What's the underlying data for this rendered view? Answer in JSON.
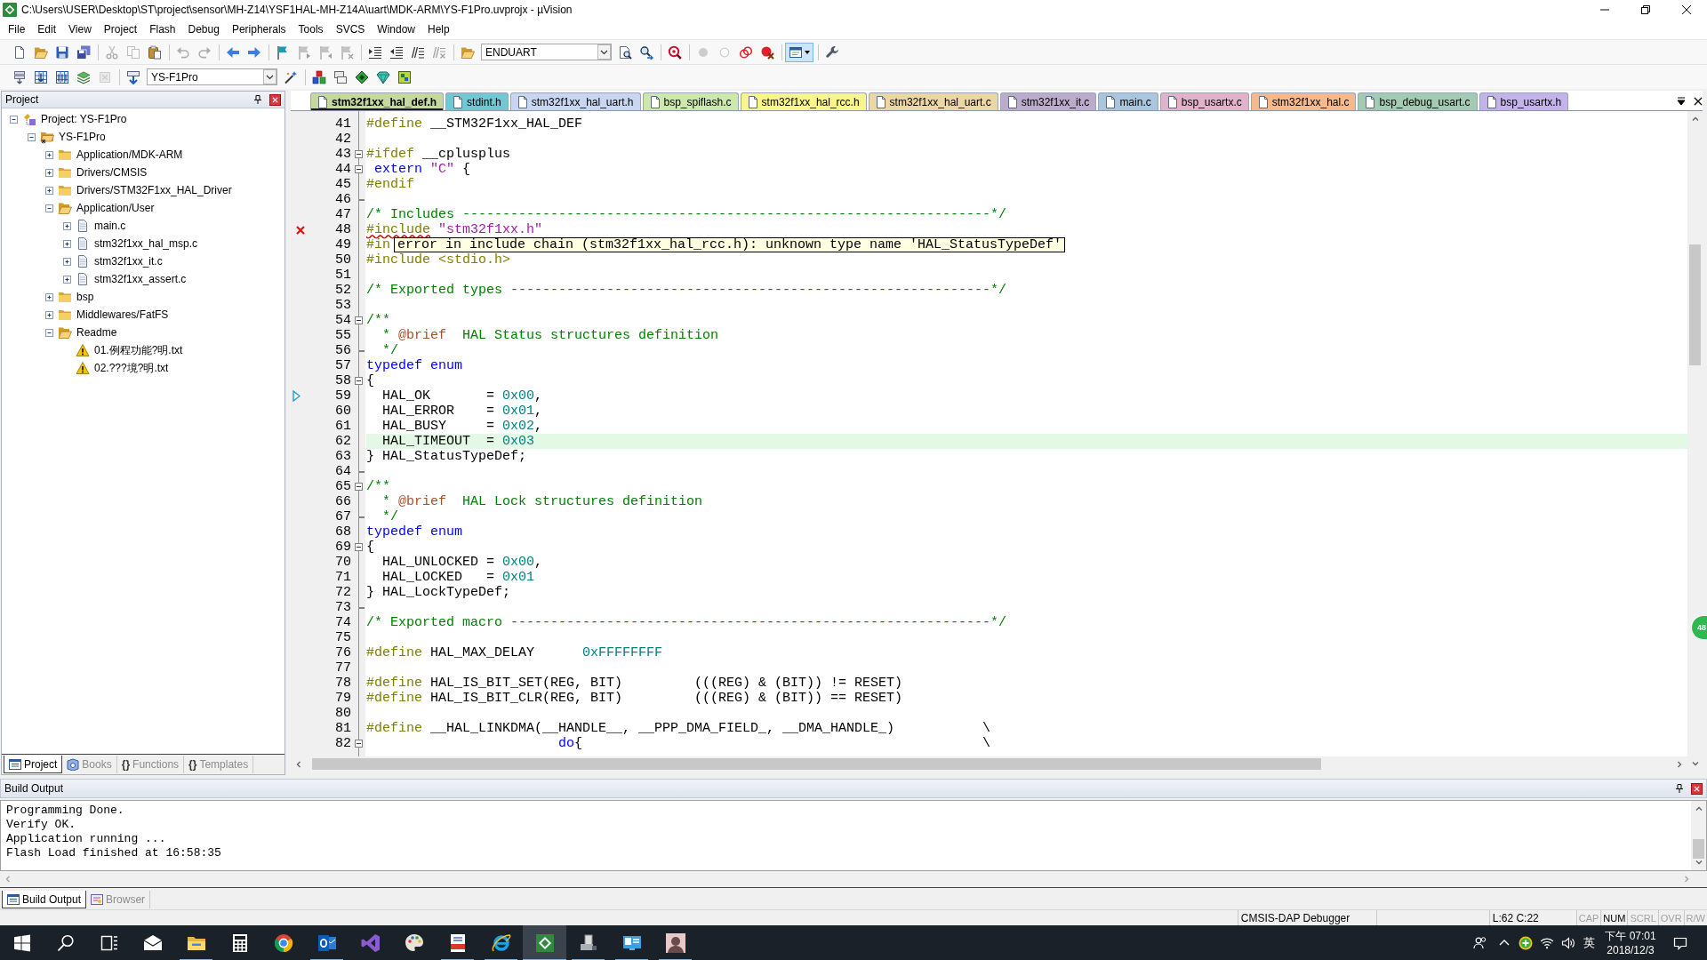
{
  "window": {
    "title": "C:\\Users\\USER\\Desktop\\ST\\project\\sensor\\MH-Z14\\YSF1HAL-MH-Z14A\\uart\\MDK-ARM\\YS-F1Pro.uvprojx - µVision"
  },
  "menu": [
    "File",
    "Edit",
    "View",
    "Project",
    "Flash",
    "Debug",
    "Peripherals",
    "Tools",
    "SVCS",
    "Window",
    "Help"
  ],
  "toolbars": [
    [
      [
        {
          "kind": "new",
          "disabled": false
        },
        {
          "kind": "open",
          "disabled": false
        },
        {
          "kind": "save",
          "disabled": false
        },
        {
          "kind": "save-all",
          "disabled": false
        }
      ],
      [
        {
          "kind": "cut",
          "disabled": true
        },
        {
          "kind": "copy",
          "disabled": true
        },
        {
          "kind": "paste",
          "disabled": false
        }
      ],
      [
        {
          "kind": "undo",
          "disabled": true
        },
        {
          "kind": "redo",
          "disabled": true
        }
      ],
      [
        {
          "kind": "back",
          "disabled": false
        },
        {
          "kind": "forward",
          "disabled": false
        }
      ],
      [
        {
          "kind": "bookmark",
          "disabled": false
        },
        {
          "kind": "prev-bookmark",
          "disabled": true
        },
        {
          "kind": "next-bookmark",
          "disabled": true
        },
        {
          "kind": "clear-bookmarks",
          "disabled": true
        }
      ],
      [
        {
          "kind": "indent",
          "disabled": false
        },
        {
          "kind": "unindent",
          "disabled": false
        },
        {
          "kind": "comment",
          "disabled": false
        },
        {
          "kind": "uncomment",
          "disabled": true
        }
      ],
      [
        {
          "kind": "find-files",
          "disabled": false
        },
        {
          "kind": "combo",
          "value": "ENDUART",
          "disabled": false
        },
        {
          "kind": "find",
          "disabled": false
        },
        {
          "kind": "find-next",
          "disabled": false
        }
      ],
      [
        {
          "kind": "debug",
          "disabled": false
        }
      ],
      [
        {
          "kind": "breakpoint",
          "disabled": true
        },
        {
          "kind": "enable-breakpoint",
          "disabled": true
        },
        {
          "kind": "disable-breakpoints",
          "disabled": false
        },
        {
          "kind": "kill-breakpoints",
          "disabled": false
        }
      ],
      [
        {
          "kind": "window",
          "pressed": true
        }
      ],
      [
        {
          "kind": "configure",
          "disabled": false
        }
      ]
    ],
    [
      [
        {
          "kind": "translate",
          "disabled": false
        },
        {
          "kind": "build",
          "disabled": false
        },
        {
          "kind": "rebuild",
          "disabled": false
        },
        {
          "kind": "batch-build",
          "disabled": false
        },
        {
          "kind": "stop-build",
          "disabled": true
        }
      ],
      [
        {
          "kind": "download",
          "disabled": false
        },
        {
          "kind": "combo",
          "value": "YS-F1Pro",
          "disabled": false
        },
        {
          "kind": "options",
          "disabled": false
        }
      ],
      [
        {
          "kind": "manage",
          "disabled": false
        },
        {
          "kind": "environment",
          "disabled": false
        },
        {
          "kind": "diamond",
          "disabled": false
        },
        {
          "kind": "gem",
          "disabled": false
        },
        {
          "kind": "pack",
          "disabled": false
        }
      ]
    ]
  ],
  "project_panel": {
    "title": "Project",
    "tree": [
      {
        "label": "Project: YS-F1Pro",
        "kind": "project",
        "expanded": true,
        "children": [
          {
            "label": "YS-F1Pro",
            "kind": "target",
            "expanded": true,
            "children": [
              {
                "label": "Application/MDK-ARM",
                "kind": "folder",
                "expanded": false
              },
              {
                "label": "Drivers/CMSIS",
                "kind": "folder",
                "expanded": false
              },
              {
                "label": "Drivers/STM32F1xx_HAL_Driver",
                "kind": "folder",
                "expanded": false
              },
              {
                "label": "Application/User",
                "kind": "folder",
                "expanded": true,
                "children": [
                  {
                    "label": "main.c",
                    "kind": "file",
                    "expanded": false
                  },
                  {
                    "label": "stm32f1xx_hal_msp.c",
                    "kind": "file",
                    "expanded": false
                  },
                  {
                    "label": "stm32f1xx_it.c",
                    "kind": "file",
                    "expanded": false
                  },
                  {
                    "label": "stm32f1xx_assert.c",
                    "kind": "file",
                    "expanded": false
                  }
                ]
              },
              {
                "label": "bsp",
                "kind": "folder",
                "expanded": false
              },
              {
                "label": "Middlewares/FatFS",
                "kind": "folder",
                "expanded": false
              },
              {
                "label": "Readme",
                "kind": "folder",
                "expanded": true,
                "children": [
                  {
                    "label": "01.例程功能?明.txt",
                    "kind": "warning-file"
                  },
                  {
                    "label": "02.???境?明.txt",
                    "kind": "warning-file"
                  }
                ]
              }
            ]
          }
        ]
      }
    ],
    "tabs": [
      {
        "kind": "project",
        "label": "Project",
        "selected": true
      },
      {
        "kind": "books",
        "label": "Books",
        "selected": false
      },
      {
        "kind": "functions",
        "glyph": "{}",
        "label": "Functions",
        "selected": false
      },
      {
        "kind": "templates",
        "glyph": "{}",
        "label": "Templates",
        "selected": false
      }
    ]
  },
  "editor": {
    "tabs": [
      {
        "label": "stm32f1xx_hal_def.h",
        "color": "#c5d99e",
        "selected": true
      },
      {
        "label": "stdint.h",
        "color": "#72c8d2",
        "selected": false
      },
      {
        "label": "stm32f1xx_hal_uart.h",
        "color": "#c9d6f2",
        "selected": false
      },
      {
        "label": "bsp_spiflash.c",
        "color": "#cde8ac",
        "selected": false
      },
      {
        "label": "stm32f1xx_hal_rcc.h",
        "color": "#f8f58c",
        "selected": false
      },
      {
        "label": "stm32f1xx_hal_uart.c",
        "color": "#ebd7a6",
        "selected": false
      },
      {
        "label": "stm32f1xx_it.c",
        "color": "#bcaccc",
        "selected": false
      },
      {
        "label": "main.c",
        "color": "#a9c6de",
        "selected": false
      },
      {
        "label": "bsp_usartx.c",
        "color": "#e2b2ca",
        "selected": false
      },
      {
        "label": "stm32f1xx_hal.c",
        "color": "#f6b98c",
        "selected": false
      },
      {
        "label": "bsp_debug_usart.c",
        "color": "#a3cbb3",
        "selected": false
      },
      {
        "label": "bsp_usartx.h",
        "color": "#c3b3ea",
        "selected": false
      }
    ],
    "lines": [
      {
        "number": "41",
        "kind": "text",
        "highlighted": false,
        "tokens": [
          {
            "kind": "preproc",
            "text": "#define"
          },
          {
            "kind": "plain",
            "text": " __STM32F1xx_HAL_DEF"
          }
        ]
      },
      {
        "number": "42",
        "kind": "text",
        "highlighted": false
      },
      {
        "number": "43",
        "kind": "fold-start",
        "highlighted": false,
        "tokens": [
          {
            "kind": "preproc",
            "text": "#ifdef"
          },
          {
            "kind": "plain",
            "text": " __cplusplus"
          }
        ]
      },
      {
        "number": "44",
        "kind": "fold-start",
        "highlighted": false,
        "tokens": [
          {
            "kind": "keyword",
            "text": " extern"
          },
          {
            "kind": "string",
            "text": " \"C\""
          },
          {
            "kind": "plain",
            "text": " {"
          }
        ]
      },
      {
        "number": "45",
        "kind": "text",
        "highlighted": false,
        "tokens": [
          {
            "kind": "preproc",
            "text": "#endif"
          }
        ]
      },
      {
        "number": "46",
        "kind": "fold-end",
        "highlighted": false
      },
      {
        "number": "47",
        "kind": "text",
        "highlighted": false,
        "tokens": [
          {
            "kind": "comment",
            "text": "/* Includes ------------------------------------------------------------------*/"
          }
        ]
      },
      {
        "number": "48",
        "kind": "error",
        "highlighted": false,
        "tokens": [
          {
            "kind": "error",
            "text": "#include"
          },
          {
            "kind": "string",
            "text": " \"stm32f1xx.h\""
          }
        ]
      },
      {
        "number": "49",
        "kind": "text",
        "highlighted": false,
        "tokens": [
          {
            "kind": "preproc",
            "text": "#in"
          }
        ],
        "tooltip": "error in include chain (stm32f1xx_hal_rcc.h): unknown type name 'HAL_StatusTypeDef'"
      },
      {
        "number": "50",
        "kind": "text",
        "highlighted": false,
        "tokens": [
          {
            "kind": "preproc",
            "text": "#include <stdio.h>"
          }
        ]
      },
      {
        "number": "51",
        "kind": "text",
        "highlighted": false
      },
      {
        "number": "52",
        "kind": "text",
        "highlighted": false,
        "tokens": [
          {
            "kind": "comment",
            "text": "/* Exported types ------------------------------------------------------------*/"
          }
        ]
      },
      {
        "number": "53",
        "kind": "text",
        "highlighted": false
      },
      {
        "number": "54",
        "kind": "fold-start",
        "highlighted": false,
        "tokens": [
          {
            "kind": "comment",
            "text": "/**"
          }
        ]
      },
      {
        "number": "55",
        "kind": "text",
        "highlighted": false,
        "tokens": [
          {
            "kind": "comment",
            "text": "  * "
          },
          {
            "kind": "doc-tag",
            "text": "@brief"
          },
          {
            "kind": "comment",
            "text": "  HAL Status structures definition"
          }
        ]
      },
      {
        "number": "56",
        "kind": "fold-end",
        "highlighted": false,
        "tokens": [
          {
            "kind": "comment",
            "text": "  */"
          }
        ]
      },
      {
        "number": "57",
        "kind": "text",
        "highlighted": false,
        "tokens": [
          {
            "kind": "keyword",
            "text": "typedef enum"
          }
        ]
      },
      {
        "number": "58",
        "kind": "fold-start",
        "highlighted": false,
        "tokens": [
          {
            "kind": "plain",
            "text": "{"
          }
        ]
      },
      {
        "number": "59",
        "kind": "marked",
        "highlighted": false,
        "tokens": [
          {
            "kind": "plain",
            "text": "  HAL_OK       = "
          },
          {
            "kind": "number",
            "text": "0x00"
          },
          {
            "kind": "plain",
            "text": ","
          }
        ]
      },
      {
        "number": "60",
        "kind": "text",
        "highlighted": false,
        "tokens": [
          {
            "kind": "plain",
            "text": "  HAL_ERROR    = "
          },
          {
            "kind": "number",
            "text": "0x01"
          },
          {
            "kind": "plain",
            "text": ","
          }
        ]
      },
      {
        "number": "61",
        "kind": "text",
        "highlighted": false,
        "tokens": [
          {
            "kind": "plain",
            "text": "  HAL_BUSY     = "
          },
          {
            "kind": "number",
            "text": "0x02"
          },
          {
            "kind": "plain",
            "text": ","
          }
        ]
      },
      {
        "number": "62",
        "kind": "text",
        "highlighted": true,
        "tokens": [
          {
            "kind": "plain",
            "text": "  HAL_TIMEOUT  = "
          },
          {
            "kind": "number",
            "text": "0x03"
          }
        ]
      },
      {
        "number": "63",
        "kind": "text",
        "highlighted": false,
        "tokens": [
          {
            "kind": "plain",
            "text": "} HAL_StatusTypeDef;"
          }
        ]
      },
      {
        "number": "64",
        "kind": "fold-end",
        "highlighted": false
      },
      {
        "number": "65",
        "kind": "fold-start",
        "highlighted": false,
        "tokens": [
          {
            "kind": "comment",
            "text": "/**"
          }
        ]
      },
      {
        "number": "66",
        "kind": "text",
        "highlighted": false,
        "tokens": [
          {
            "kind": "comment",
            "text": "  * "
          },
          {
            "kind": "doc-tag",
            "text": "@brief"
          },
          {
            "kind": "comment",
            "text": "  HAL Lock structures definition"
          }
        ]
      },
      {
        "number": "67",
        "kind": "fold-end",
        "highlighted": false,
        "tokens": [
          {
            "kind": "comment",
            "text": "  */"
          }
        ]
      },
      {
        "number": "68",
        "kind": "text",
        "highlighted": false,
        "tokens": [
          {
            "kind": "keyword",
            "text": "typedef enum"
          }
        ]
      },
      {
        "number": "69",
        "kind": "fold-start",
        "highlighted": false,
        "tokens": [
          {
            "kind": "plain",
            "text": "{"
          }
        ]
      },
      {
        "number": "70",
        "kind": "text",
        "highlighted": false,
        "tokens": [
          {
            "kind": "plain",
            "text": "  HAL_UNLOCKED = "
          },
          {
            "kind": "number",
            "text": "0x00"
          },
          {
            "kind": "plain",
            "text": ","
          }
        ]
      },
      {
        "number": "71",
        "kind": "text",
        "highlighted": false,
        "tokens": [
          {
            "kind": "plain",
            "text": "  HAL_LOCKED   = "
          },
          {
            "kind": "number",
            "text": "0x01"
          }
        ]
      },
      {
        "number": "72",
        "kind": "text",
        "highlighted": false,
        "tokens": [
          {
            "kind": "plain",
            "text": "} HAL_LockTypeDef;"
          }
        ]
      },
      {
        "number": "73",
        "kind": "fold-end",
        "highlighted": false
      },
      {
        "number": "74",
        "kind": "text",
        "highlighted": false,
        "tokens": [
          {
            "kind": "comment",
            "text": "/* Exported macro ------------------------------------------------------------*/"
          }
        ]
      },
      {
        "number": "75",
        "kind": "text",
        "highlighted": false
      },
      {
        "number": "76",
        "kind": "text",
        "highlighted": false,
        "tokens": [
          {
            "kind": "preproc",
            "text": "#define"
          },
          {
            "kind": "plain",
            "text": " HAL_MAX_DELAY      "
          },
          {
            "kind": "number",
            "text": "0xFFFFFFFF"
          }
        ]
      },
      {
        "number": "77",
        "kind": "text",
        "highlighted": false
      },
      {
        "number": "78",
        "kind": "text",
        "highlighted": false,
        "tokens": [
          {
            "kind": "preproc",
            "text": "#define"
          },
          {
            "kind": "plain",
            "text": " HAL_IS_BIT_SET(REG, BIT)         (((REG) & (BIT)) != RESET)"
          }
        ]
      },
      {
        "number": "79",
        "kind": "text",
        "highlighted": false,
        "tokens": [
          {
            "kind": "preproc",
            "text": "#define"
          },
          {
            "kind": "plain",
            "text": " HAL_IS_BIT_CLR(REG, BIT)         (((REG) & (BIT)) == RESET)"
          }
        ]
      },
      {
        "number": "80",
        "kind": "text",
        "highlighted": false
      },
      {
        "number": "81",
        "kind": "text",
        "highlighted": false,
        "tokens": [
          {
            "kind": "preproc",
            "text": "#define"
          },
          {
            "kind": "plain",
            "text": " __HAL_LINKDMA(__HANDLE__, __PPP_DMA_FIELD_, __DMA_HANDLE_)           \\"
          }
        ]
      },
      {
        "number": "82",
        "kind": "fold-start",
        "highlighted": false,
        "tokens": [
          {
            "kind": "keyword",
            "text": "                        do"
          },
          {
            "kind": "plain",
            "text": "{                                                  \\"
          }
        ]
      }
    ]
  },
  "floating_badge": "48",
  "build_output": {
    "title": "Build Output",
    "lines": [
      "Programming Done.",
      "Verify OK.",
      "Application running ...",
      "Flash Load finished at 16:58:35"
    ],
    "tabs": [
      {
        "kind": "build",
        "label": "Build Output",
        "selected": true
      },
      {
        "kind": "browser",
        "label": "Browser",
        "selected": false
      }
    ]
  },
  "status_bar": {
    "debugger": "CMSIS-DAP Debugger",
    "cursor_position": "L:62 C:22",
    "indicators": [
      {
        "label": "CAP",
        "on": false
      },
      {
        "label": "NUM",
        "on": true
      },
      {
        "label": "SCRL",
        "on": false
      },
      {
        "label": "OVR",
        "on": false
      },
      {
        "label": "R/W",
        "on": false
      }
    ]
  },
  "taskbar": {
    "apps": [
      {
        "kind": "start",
        "running": false,
        "selected": false
      },
      {
        "kind": "search",
        "running": false,
        "selected": false
      },
      {
        "kind": "task-view",
        "running": false,
        "selected": false
      },
      {
        "kind": "mail",
        "running": false,
        "selected": false
      },
      {
        "kind": "files",
        "running": true,
        "selected": false
      },
      {
        "kind": "calculator",
        "running": false,
        "selected": false
      },
      {
        "kind": "browser",
        "running": false,
        "selected": false
      },
      {
        "kind": "email",
        "running": true,
        "selected": false
      },
      {
        "kind": "ide",
        "running": false,
        "selected": false
      },
      {
        "kind": "paint",
        "running": false,
        "selected": false
      },
      {
        "kind": "pdf",
        "running": true,
        "selected": false
      },
      {
        "kind": "web",
        "running": true,
        "selected": false
      },
      {
        "kind": "uvision",
        "running": true,
        "selected": true
      },
      {
        "kind": "network",
        "running": true,
        "selected": false
      },
      {
        "kind": "monitor",
        "running": true,
        "selected": false
      },
      {
        "kind": "avatar",
        "running": true,
        "selected": false
      }
    ],
    "input_method": "英",
    "time": "下午 07:01",
    "date": "2018/12/3"
  }
}
